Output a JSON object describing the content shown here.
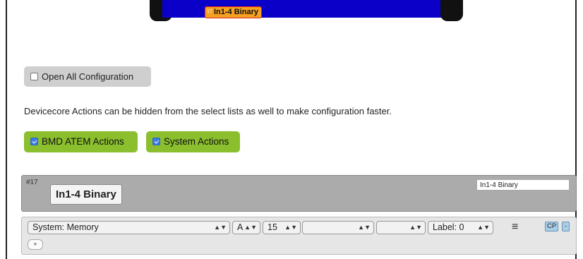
{
  "header": {
    "tag_number": "17",
    "tag_label": "In1-4 Binary",
    "bar_color": "#0a00c8"
  },
  "open_all": {
    "label": "Open All Configuration",
    "checked": false
  },
  "description": "Devicecore Actions can be hidden from the select lists as well to make configuration faster.",
  "filters": [
    {
      "label": "BMD ATEM Actions",
      "checked": true
    },
    {
      "label": "System Actions",
      "checked": true
    }
  ],
  "panel": {
    "number": "#17",
    "title": "In1-4 Binary",
    "name_value": "In1-4 Binary"
  },
  "action_row": {
    "device_select": "System: Memory",
    "bank_select": "A",
    "index_select": "15",
    "param1_select": "",
    "param2_select": "",
    "label_select": "Label: 0",
    "cp_label": "CP",
    "remove_label": "-",
    "add_label": "+"
  },
  "colors": {
    "accent_green": "#8bbf2e",
    "tag_orange": "#f5a020",
    "panel_gray": "#ababab"
  },
  "icons": {
    "menu": "hamburger-menu-icon",
    "select_arrow": "updown-arrow-icon",
    "checkbox": "checkbox-icon"
  }
}
